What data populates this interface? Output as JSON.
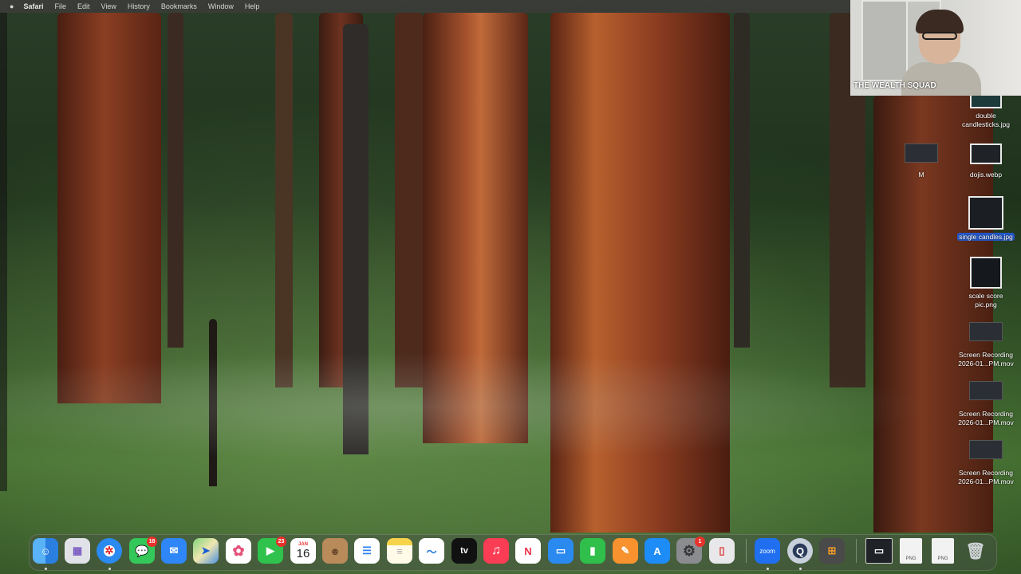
{
  "menubar": {
    "apple": "",
    "app_name": "Safari",
    "items": [
      "File",
      "Edit",
      "View",
      "History",
      "Bookmarks",
      "Window",
      "Help"
    ]
  },
  "webcam": {
    "label": "THE WEALTH SQUAD"
  },
  "desktop": {
    "icons": [
      {
        "label": "double candlesticks.jpg"
      },
      {
        "label": "M"
      },
      {
        "label": "dojis.webp"
      },
      {
        "label": "single candles.jpg"
      },
      {
        "label": "scale score pic.png"
      },
      {
        "label": "Screen Recording 2026-01...PM.mov"
      },
      {
        "label": "Screen Recording 2026-01...PM.mov"
      },
      {
        "label": "Screen Recording 2026-01...PM.mov"
      }
    ]
  },
  "dock": {
    "apps": [
      {
        "name": "Finder",
        "glyph": "☺"
      },
      {
        "name": "Launchpad",
        "glyph": "▦"
      },
      {
        "name": "Safari",
        "glyph": "✲"
      },
      {
        "name": "Messages",
        "glyph": "💬",
        "badge": "18"
      },
      {
        "name": "Mail",
        "glyph": "✉"
      },
      {
        "name": "Maps",
        "glyph": "➤"
      },
      {
        "name": "Photos",
        "glyph": "✿"
      },
      {
        "name": "FaceTime",
        "glyph": "▶",
        "badge": "23"
      },
      {
        "name": "Calendar",
        "month": "JAN",
        "day": "16"
      },
      {
        "name": "Contacts",
        "glyph": "☻"
      },
      {
        "name": "Reminders",
        "glyph": "☰"
      },
      {
        "name": "Notes",
        "glyph": "≡"
      },
      {
        "name": "Freeform",
        "glyph": "〜"
      },
      {
        "name": "Apple TV",
        "glyph": "tv"
      },
      {
        "name": "Music",
        "glyph": "♫"
      },
      {
        "name": "News",
        "glyph": "N"
      },
      {
        "name": "Keynote",
        "glyph": "▭"
      },
      {
        "name": "Numbers",
        "glyph": "▮"
      },
      {
        "name": "Pages",
        "glyph": "✎"
      },
      {
        "name": "App Store",
        "glyph": "A"
      },
      {
        "name": "System Settings",
        "glyph": "⚙",
        "badge": "1"
      },
      {
        "name": "iPhone Mirroring",
        "glyph": "▯"
      },
      {
        "name": "Zoom",
        "label": "zoom"
      },
      {
        "name": "QuickTime Player",
        "glyph": "Q"
      },
      {
        "name": "Calculator",
        "glyph": "⊞"
      },
      {
        "name": "Screenshot folder",
        "glyph": "▭"
      },
      {
        "name": "PNG file",
        "label": "PNG"
      },
      {
        "name": "PNG file",
        "label": "PNG"
      },
      {
        "name": "Trash",
        "glyph": "🗑"
      }
    ]
  }
}
